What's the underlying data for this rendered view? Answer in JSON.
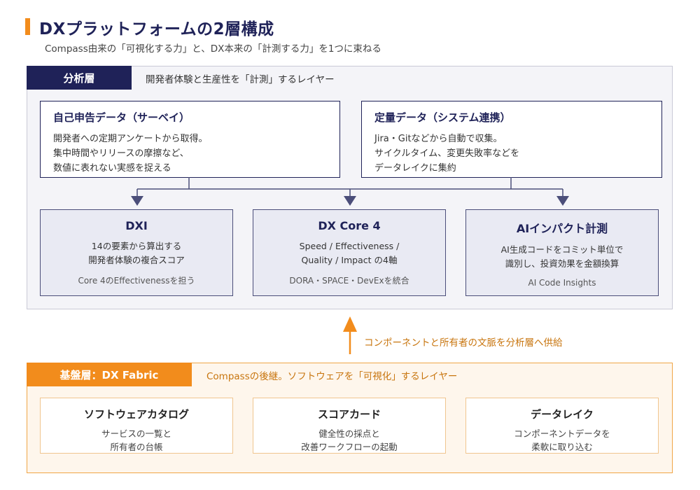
{
  "header": {
    "title": "DXプラットフォームの2層構成",
    "subtitle": "Compass由来の「可視化する力」と、DX本来の「計測する力」を1つに束ねる"
  },
  "analysis_layer": {
    "tag": "分析層",
    "description": "開発者体験と生産性を「計測」するレイヤー",
    "sources": [
      {
        "title": "自己申告データ（サーベイ）",
        "lines": [
          "開発者への定期アンケートから取得。",
          "集中時間やリリースの摩擦など、",
          "数値に表れない実感を捉える"
        ]
      },
      {
        "title": "定量データ（システム連携）",
        "lines": [
          "Jira・Gitなどから自動で収集。",
          "サイクルタイム、変更失敗率などを",
          "データレイクに集約"
        ]
      }
    ],
    "metrics": [
      {
        "title": "DXI",
        "desc": [
          "14の要素から算出する",
          "開発者体験の複合スコア"
        ],
        "foot": "Core 4のEffectivenessを担う"
      },
      {
        "title": "DX Core 4",
        "desc": [
          "Speed / Effectiveness /",
          "Quality / Impact の4軸"
        ],
        "foot": "DORA・SPACE・DevExを統合"
      },
      {
        "title": "AIインパクト計測",
        "desc": [
          "AI生成コードをコミット単位で",
          "識別し、投資効果を金額換算"
        ],
        "foot": "AI Code Insights"
      }
    ]
  },
  "link": {
    "label": "コンポーネントと所有者の文脈を分析層へ供給"
  },
  "fabric_layer": {
    "tag": "基盤層：DX Fabric",
    "description": "Compassの後継。ソフトウェアを「可視化」するレイヤー",
    "items": [
      {
        "title": "ソフトウェアカタログ",
        "desc": [
          "サービスの一覧と",
          "所有者の台帳"
        ]
      },
      {
        "title": "スコアカード",
        "desc": [
          "健全性の採点と",
          "改善ワークフローの起動"
        ]
      },
      {
        "title": "データレイク",
        "desc": [
          "コンポーネントデータを",
          "柔軟に取り込む"
        ]
      }
    ]
  },
  "colors": {
    "navy": "#1f2258",
    "orange": "#f28c1c",
    "connector": "#4b4e7a"
  }
}
